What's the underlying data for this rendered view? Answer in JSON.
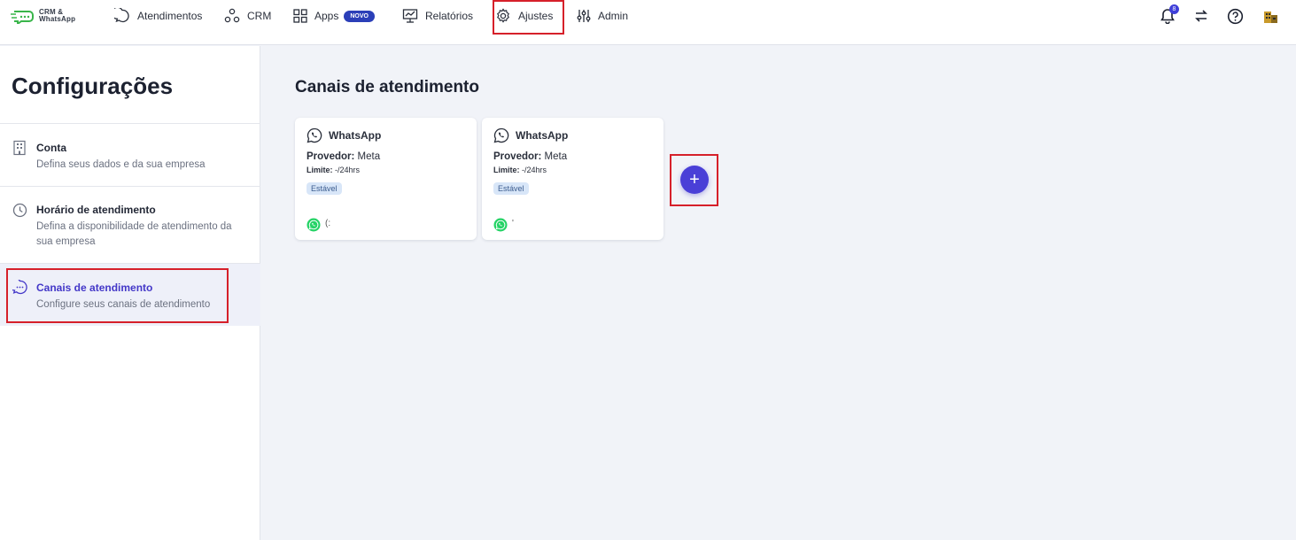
{
  "brand": {
    "line1": "CRM &",
    "line2": "WhatsApp"
  },
  "nav": {
    "atendimentos": "Atendimentos",
    "crm": "CRM",
    "apps": "Apps",
    "apps_badge": "NOVO",
    "relatorios": "Relatórios",
    "ajustes": "Ajustes",
    "admin": "Admin"
  },
  "notifications": {
    "count": "8"
  },
  "sidebar": {
    "title": "Configurações",
    "items": [
      {
        "label": "Conta",
        "desc": "Defina seus dados e da sua empresa",
        "icon": "building-icon"
      },
      {
        "label": "Horário de atendimento",
        "desc": "Defina a disponibilidade de atendimento da sua empresa",
        "icon": "clock-icon"
      },
      {
        "label": "Canais de atendimento",
        "desc": "Configure seus canais de atendimento",
        "icon": "chat-bubble-icon"
      }
    ]
  },
  "main": {
    "title": "Canais de atendimento",
    "cards": [
      {
        "name": "WhatsApp",
        "provider_label": "Provedor:",
        "provider": "Meta",
        "limit_label": "Limite:",
        "limit": "-/24hrs",
        "status": "Estável",
        "number": "(:"
      },
      {
        "name": "WhatsApp",
        "provider_label": "Provedor:",
        "provider": "Meta",
        "limit_label": "Limite:",
        "limit": "-/24hrs",
        "status": "Estável",
        "number": "'"
      }
    ],
    "add_label": "+"
  },
  "colors": {
    "accent": "#4a3fd7",
    "highlight": "#d6202a",
    "whatsapp": "#25d366"
  }
}
